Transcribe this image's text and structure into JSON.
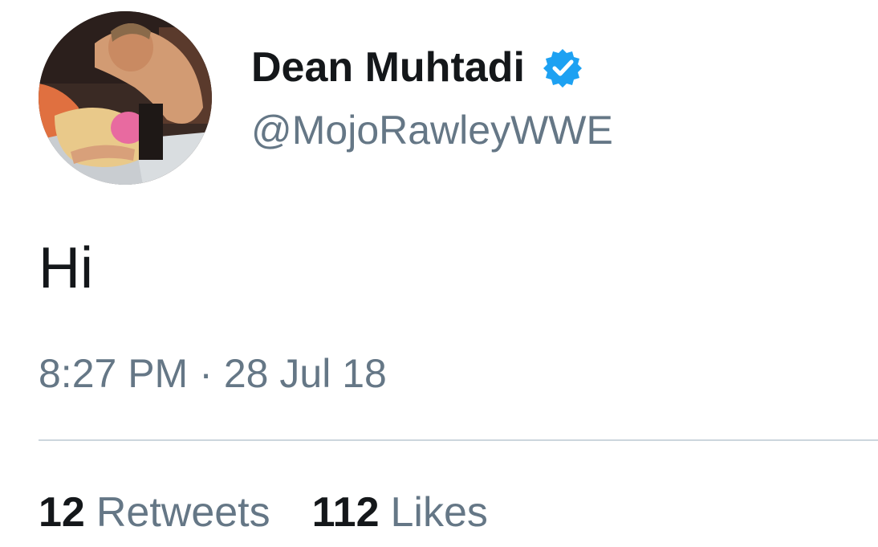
{
  "tweet": {
    "author": {
      "display_name": "Dean Muhtadi",
      "handle": "@MojoRawleyWWE",
      "verified": true,
      "verified_icon": "verified-badge-icon",
      "avatar": "profile-avatar"
    },
    "text": "Hi",
    "time": "8:27 PM",
    "separator": "·",
    "date": "28 Jul 18",
    "stats": {
      "retweets_count": "12",
      "retweets_label": "Retweets",
      "likes_count": "112",
      "likes_label": "Likes"
    }
  },
  "colors": {
    "primary_text": "#14171a",
    "secondary_text": "#657786",
    "verified_blue": "#1da1f2",
    "divider": "#ccd6dd"
  }
}
